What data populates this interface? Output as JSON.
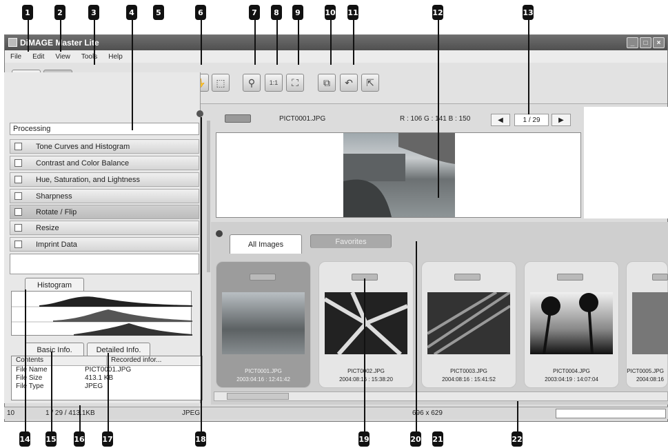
{
  "window": {
    "title": "DiMAGE Master Lite",
    "min": "_",
    "max": "□",
    "close": "×"
  },
  "menu": [
    {
      "key": "file",
      "label": "File"
    },
    {
      "key": "edit",
      "label": "Edit"
    },
    {
      "key": "view",
      "label": "View"
    },
    {
      "key": "tools",
      "label": "Tools"
    },
    {
      "key": "help",
      "label": "Help"
    }
  ],
  "toolbar": {
    "icons": {
      "thumbnail": "grid-icon",
      "edit": "edit-icon",
      "save": "save-icon",
      "print": "print-icon",
      "rotate_left": "rotate-left-icon",
      "rotate_right": "rotate-right-icon",
      "hand": "hand-icon",
      "select": "select-icon",
      "zoom": "zoom-icon",
      "actual": "actual-size-icon",
      "fit": "fit-icon",
      "compare": "compare-icon",
      "undo": "undo-icon",
      "export": "export-icon"
    },
    "glyphs": {
      "thumbnail": "▦",
      "edit": "✎",
      "save": "▣",
      "print": "⎙",
      "rotate_left": "⟲",
      "rotate_right": "⟳",
      "hand": "✋",
      "select": "⬚",
      "zoom": "⚲",
      "actual": "1:1",
      "fit": "⛶",
      "compare": "⧉",
      "undo": "↶",
      "export": "⇱"
    }
  },
  "processing": {
    "header": "Processing",
    "items": [
      "Tone Curves and Histogram",
      "Contrast and Color Balance",
      "Hue, Saturation, and Lightness",
      "Sharpness",
      "Rotate / Flip",
      "Resize",
      "Imprint Data"
    ],
    "selected_index": 4
  },
  "histogram_tab": "Histogram",
  "info_tabs": {
    "basic": "Basic Info.",
    "detailed": "Detailed Info."
  },
  "info_table": {
    "headers": [
      "Contents",
      "Recorded infor..."
    ],
    "rows": [
      [
        "File Name",
        "PICT0001.JPG"
      ],
      [
        "File Size",
        "413.1 KB"
      ],
      [
        "File Type",
        "JPEG"
      ]
    ]
  },
  "status": {
    "left": "10",
    "count": "1 / 29 / 413.1KB",
    "type": "JPEG",
    "dims": "696 x 629"
  },
  "preview": {
    "filename": "PICT0001.JPG",
    "rgb": "R : 106  G : 141  B : 150",
    "page": "1 / 29",
    "prev": "◀",
    "next": "▶"
  },
  "tabs": {
    "all": "All Images",
    "favorites": "Favorites"
  },
  "thumbnails": [
    {
      "name": "PICT0001.JPG",
      "date": "2003:04:16 : 12:41:42"
    },
    {
      "name": "PICT0002.JPG",
      "date": "2004:08:16 : 15:38:20"
    },
    {
      "name": "PICT0003.JPG",
      "date": "2004:08:16 : 15:41:52"
    },
    {
      "name": "PICT0004.JPG",
      "date": "2003:04:19 : 14:07:04"
    },
    {
      "name": "PICT0005.JPG",
      "date": "2004:08:16"
    }
  ],
  "callouts": [
    "1",
    "2",
    "3",
    "4",
    "5",
    "6",
    "7",
    "8",
    "9",
    "10",
    "11",
    "12",
    "13",
    "14",
    "15",
    "16",
    "17",
    "18",
    "19",
    "20",
    "21",
    "22"
  ],
  "colors": {
    "callout": "#111111",
    "titlebar": "#5a5a5a",
    "panel": "#dcdcdc"
  }
}
